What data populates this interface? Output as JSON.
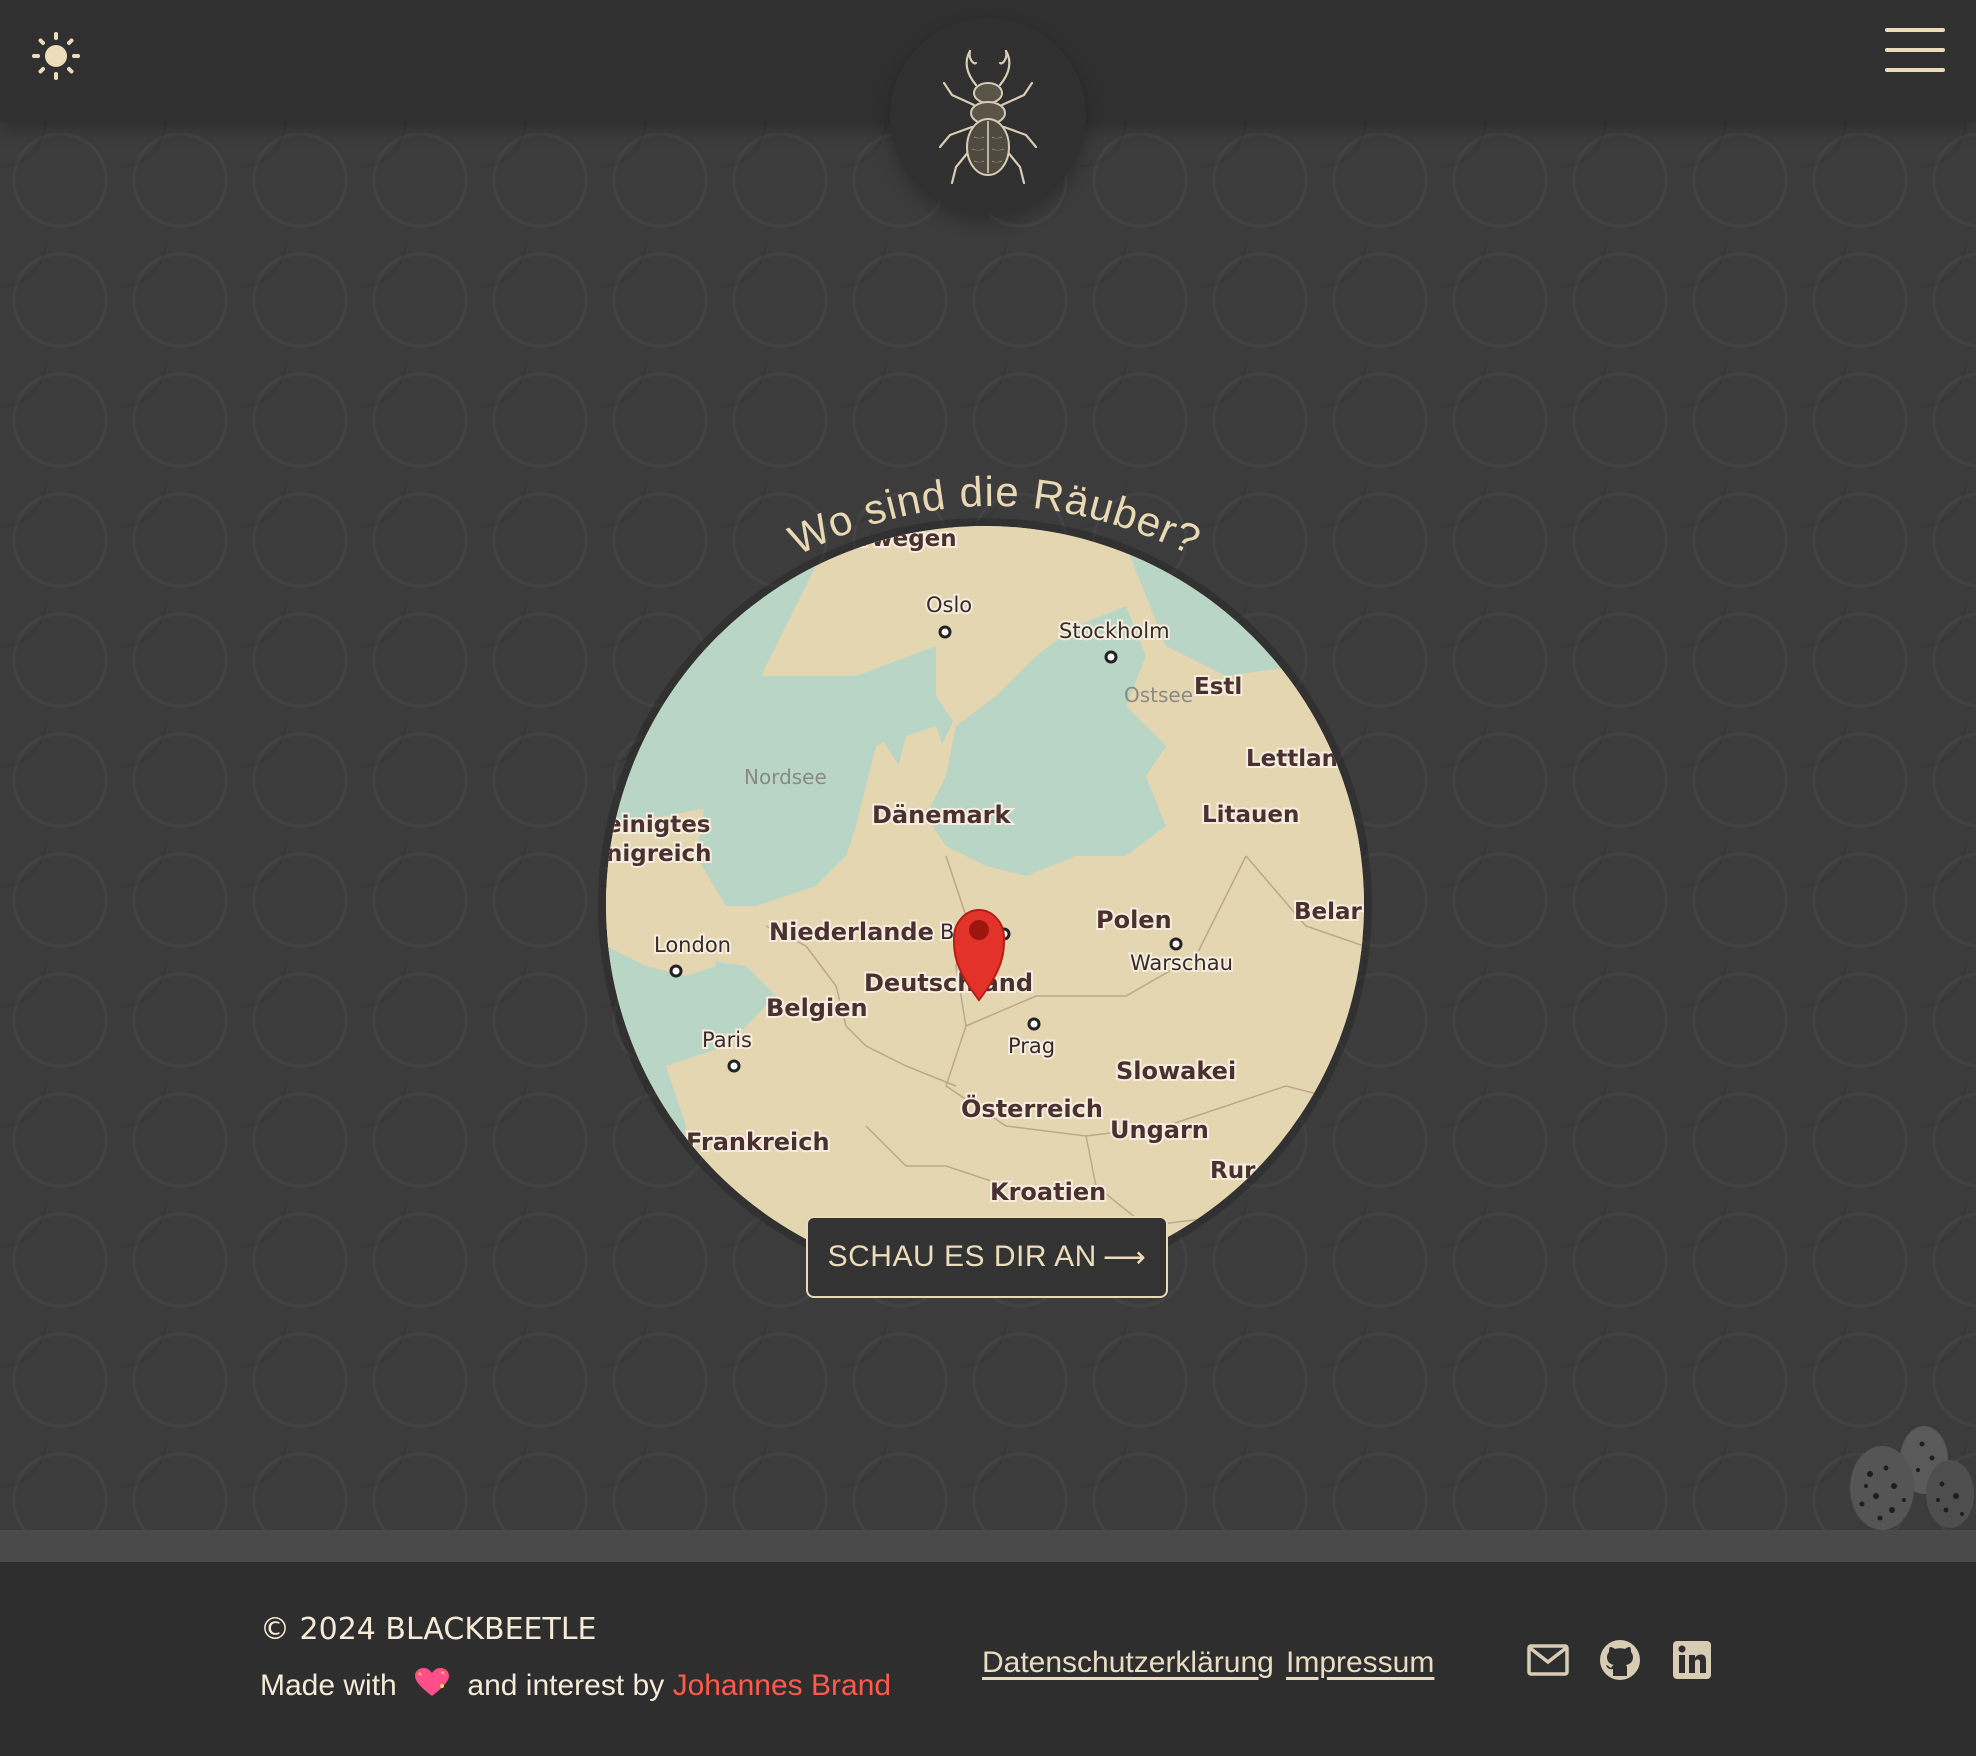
{
  "header": {
    "theme_toggle_icon": "sun-icon",
    "logo_icon": "stag-beetle-logo",
    "menu_icon": "hamburger-menu-icon"
  },
  "map_section": {
    "title": "Wo sind die Räuber?",
    "labels": {
      "norwegen": "rwegen",
      "oslo": "Oslo",
      "stockholm": "Stockholm",
      "ostsee": "Ostsee",
      "estland": "Estl",
      "nordsee": "Nordsee",
      "lettland": "Lettlan",
      "daenemark": "Dänemark",
      "litauen": "Litauen",
      "uk1": "einigtes",
      "uk2": "nigreich",
      "belarus": "Belar",
      "niederlande": "Niederlande",
      "berlin": "Be",
      "polen": "Polen",
      "london": "London",
      "warschau": "Warschau",
      "deutschland": "Deutschland",
      "belgien": "Belgien",
      "paris": "Paris",
      "prag": "Prag",
      "slowakei": "Slowakei",
      "oesterreich": "Österreich",
      "ungarn": "Ungarn",
      "frankreich": "Frankreich",
      "rumaenien": "Rur",
      "kroatien": "Kroatien"
    },
    "cta_label": "SCHAU ES DIR AN",
    "cta_arrow": "⟶",
    "colors": {
      "water": "#b8d5c6",
      "land": "#e5d6b2",
      "pin": "#e3322a"
    }
  },
  "footer": {
    "copyright": "© 2024 BLACKBEETLE",
    "made_with_prefix": "Made with",
    "made_with_middle": "and interest by",
    "author": "Johannes Brand",
    "links": {
      "privacy": "Datenschutzerklärung",
      "imprint": "Impressum"
    },
    "social_icons": [
      "mail-icon",
      "github-icon",
      "linkedin-icon"
    ],
    "colors": {
      "accent": "#ff5a4a",
      "text": "#f4ead7"
    }
  }
}
